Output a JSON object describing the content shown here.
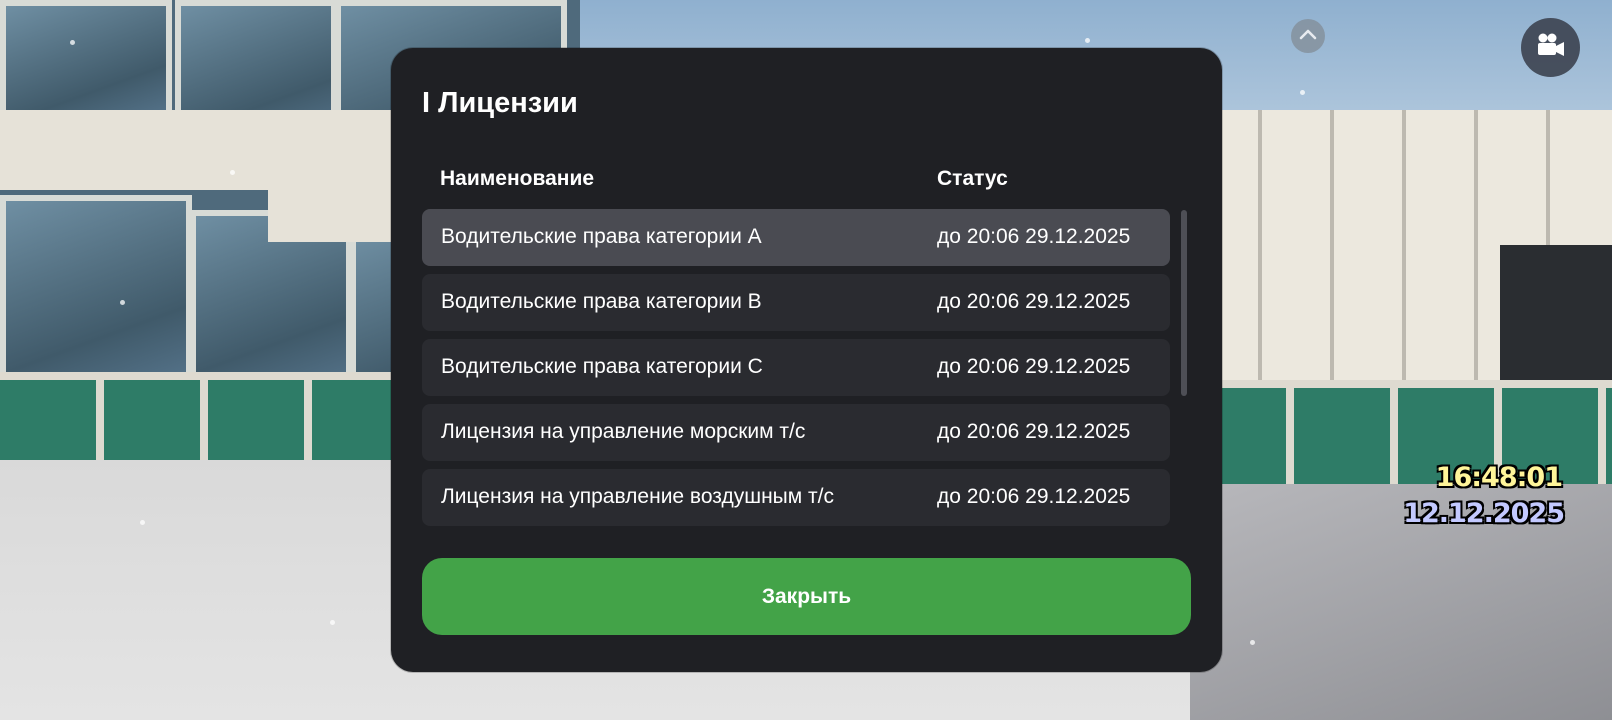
{
  "dialog": {
    "title": "I Лицензии",
    "columns": {
      "name": "Наименование",
      "status": "Статус"
    },
    "licenses": [
      {
        "name": "Водительские права категории A",
        "status": "до 20:06 29.12.2025",
        "selected": true
      },
      {
        "name": "Водительские права категории B",
        "status": "до 20:06 29.12.2025"
      },
      {
        "name": "Водительские права категории C",
        "status": "до 20:06 29.12.2025"
      },
      {
        "name": "Лицензия на управление морским т/с",
        "status": "до 20:06 29.12.2025"
      },
      {
        "name": "Лицензия на управление воздушным т/с",
        "status": "до 20:06 29.12.2025"
      }
    ],
    "close_label": "Закрыть"
  },
  "hud": {
    "time": "16:48:01",
    "date": "12.12.2025",
    "icons": [
      "chevron-up-icon",
      "video-camera-icon"
    ]
  },
  "colors": {
    "dialog_bg": "#1f2024",
    "row_bg": "#2a2b30",
    "row_selected_bg": "#4a4b52",
    "close_button": "#43a348",
    "time_text": "#fff59a",
    "date_text": "#c3c9ff"
  }
}
